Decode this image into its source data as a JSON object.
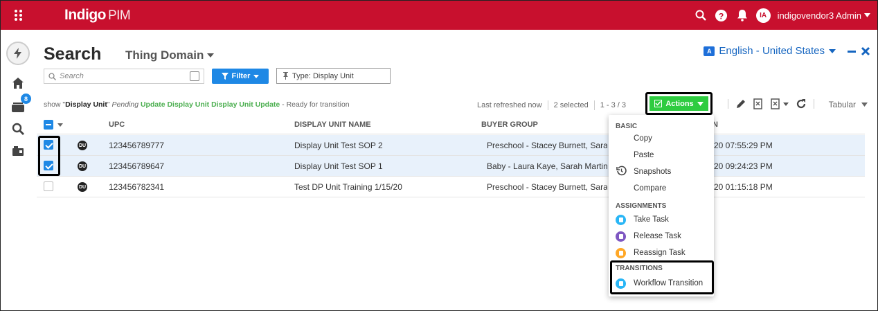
{
  "app": {
    "logo": "Indigo",
    "logo_suffix": "PIM",
    "avatar_initials": "IA",
    "user": "indigovendor3 Admin"
  },
  "rail": {
    "badge_count": "8"
  },
  "header": {
    "title": "Search",
    "domain": "Thing Domain",
    "language": "English - United States"
  },
  "search": {
    "placeholder": "Search",
    "filter_label": "Filter",
    "type_chip": "Type: Display Unit"
  },
  "status": {
    "prefix": "show \"",
    "entity": "Display Unit",
    "mid": "\" ",
    "pending": "Pending ",
    "workflow": "Update Display Unit Display Unit Update",
    "suffix": " - Ready for transition"
  },
  "meta": {
    "refreshed": "Last refreshed now",
    "selected": "2 selected",
    "range": "1 - 3 / 3"
  },
  "toolbar": {
    "actions_label": "Actions",
    "view_label": "Tabular"
  },
  "columns": {
    "upc": "UPC",
    "name": "DISPLAY UNIT NAME",
    "buyer": "BUYER GROUP",
    "last": "N"
  },
  "rows": [
    {
      "badge": "DU",
      "upc": "123456789777",
      "name": "Display Unit Test SOP 2",
      "buyer": "Preschool - Stacey Burnett, Sara",
      "date": "20 07:55:29 PM",
      "checked": true
    },
    {
      "badge": "DU",
      "upc": "123456789647",
      "name": "Display Unit Test SOP 1",
      "buyer": "Baby - Laura Kaye, Sarah Martin",
      "date": "20 09:24:23 PM",
      "checked": true
    },
    {
      "badge": "DU",
      "upc": "123456782341",
      "name": "Test DP Unit Training 1/15/20",
      "buyer": "Preschool - Stacey Burnett, Sara",
      "date": "20 01:15:18 PM",
      "checked": false
    }
  ],
  "menu": {
    "basic": "BASIC",
    "copy": "Copy",
    "paste": "Paste",
    "snapshots": "Snapshots",
    "compare": "Compare",
    "assignments": "ASSIGNMENTS",
    "take_task": "Take Task",
    "release_task": "Release Task",
    "reassign_task": "Reassign Task",
    "transitions": "TRANSITIONS",
    "workflow_transition": "Workflow Transition"
  },
  "colors": {
    "brand": "#c8102e",
    "accent": "#1e88e5",
    "actions": "#2ecc40",
    "take": "#29b6f6",
    "release": "#7e57c2",
    "reassign": "#ffa726"
  }
}
